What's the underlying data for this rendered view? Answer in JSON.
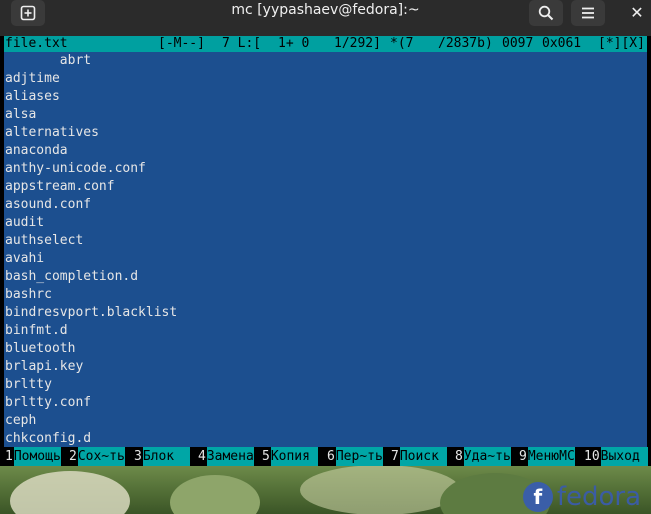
{
  "window": {
    "title": "mc [yypashaev@fedora]:~",
    "new_tab_icon": "plus-square-icon",
    "search_icon": "search-icon",
    "menu_icon": "hamburger-menu-icon",
    "close_glyph": "✕"
  },
  "editor": {
    "status": {
      "filename": "file.txt",
      "mode": "[-M--]",
      "col": "7 L:[",
      "pos": "1+ 0",
      "lines": "1/292]",
      "chars": "*(7",
      "bytes": "/2837b)",
      "code_dec": "0097",
      "code_hex": "0x061",
      "flags": "[*][X]"
    },
    "lines": [
      "       abrt",
      "adjtime",
      "aliases",
      "alsa",
      "alternatives",
      "anaconda",
      "anthy-unicode.conf",
      "appstream.conf",
      "asound.conf",
      "audit",
      "authselect",
      "avahi",
      "bash_completion.d",
      "bashrc",
      "bindresvport.blacklist",
      "binfmt.d",
      "bluetooth",
      "brlapi.key",
      "brltty",
      "brltty.conf",
      "ceph",
      "chkconfig.d"
    ]
  },
  "function_keys": [
    {
      "num": "1",
      "label": "Помощь"
    },
    {
      "num": "2",
      "label": "Сох~ть"
    },
    {
      "num": "3",
      "label": "Блок  "
    },
    {
      "num": "4",
      "label": "Замена"
    },
    {
      "num": "5",
      "label": "Копия "
    },
    {
      "num": "6",
      "label": "Пер~ть"
    },
    {
      "num": "7",
      "label": "Поиск "
    },
    {
      "num": "8",
      "label": "Уда~ть"
    },
    {
      "num": "9",
      "label": "МенюMC"
    },
    {
      "num": "10",
      "label": "Выход "
    }
  ],
  "desktop": {
    "logo_word": "fedora",
    "logo_mark": "f"
  },
  "colors": {
    "editor_bg": "#1c4f8f",
    "status_bg": "#00a0a0",
    "fkey_label_bg": "#00a6a6",
    "titlebar_bg": "#2b2b2b"
  }
}
